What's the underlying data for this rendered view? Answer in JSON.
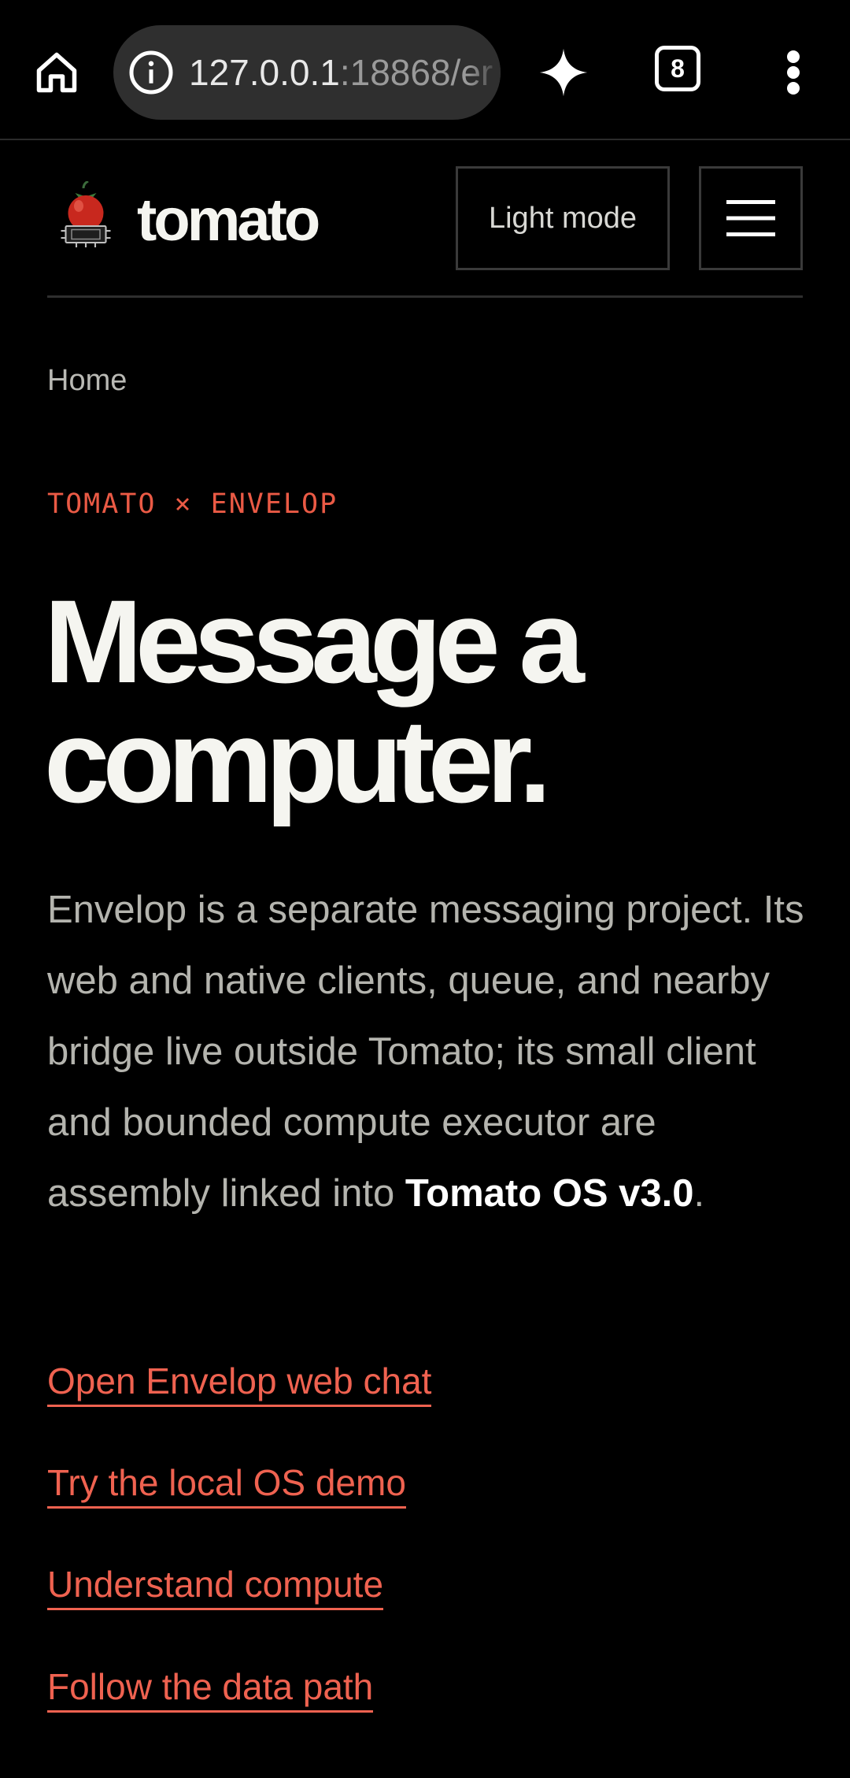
{
  "browser": {
    "url_host": "127.0.0.1",
    "url_rest": ":18868/er",
    "tab_count": "8",
    "icons": {
      "home": "home-icon",
      "info": "info-icon",
      "assistant": "sparkle-icon",
      "tabs": "tab-count-icon",
      "menu": "more-vertical-icon"
    }
  },
  "header": {
    "brand": "tomato",
    "theme_toggle_label": "Light mode",
    "menu_icon": "hamburger-menu-icon",
    "logo_icon": "tomato-chip-logo"
  },
  "breadcrumb": {
    "home": "Home"
  },
  "hero": {
    "eyebrow": "TOMATO × ENVELOP",
    "title_line1": "Message a",
    "title_line2": "computer.",
    "intro_text": "Envelop is a separate messaging project. Its web and native clients, queue, and nearby bridge live outside Tomato; its small client and bounded compute executor are assembly linked into ",
    "intro_emphasis": "Tomato OS v3.0",
    "intro_end": "."
  },
  "links": [
    {
      "label": "Open Envelop web chat"
    },
    {
      "label": "Try the local OS demo"
    },
    {
      "label": "Understand compute"
    },
    {
      "label": "Follow the data path"
    }
  ],
  "colors": {
    "background": "#000000",
    "accent": "#ea5a45",
    "text_primary": "#f5f5f0",
    "text_muted": "#b4b4ae",
    "url_pill": "#2f2f2f"
  }
}
